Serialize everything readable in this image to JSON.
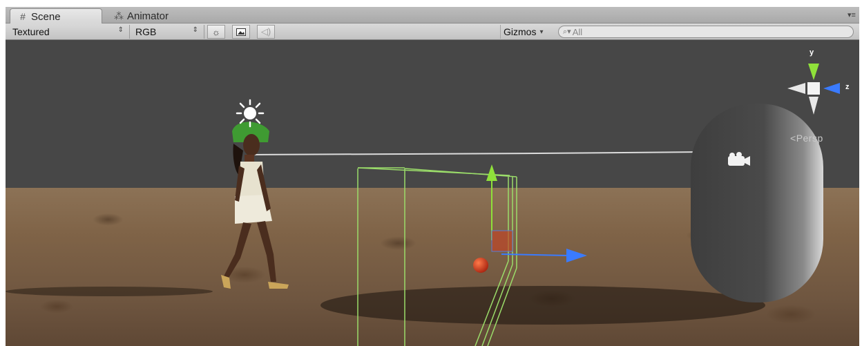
{
  "tabs": [
    {
      "label": "Scene",
      "icon": "grid-icon",
      "active": true
    },
    {
      "label": "Animator",
      "icon": "animator-icon",
      "active": false
    }
  ],
  "toolbar": {
    "render_mode": "Textured",
    "color_mode": "RGB",
    "lighting_icon": "sun-icon",
    "image_icon": "image-icon",
    "audio_icon": "speaker-icon",
    "gizmos_label": "Gizmos",
    "search_placeholder": "All"
  },
  "viewport": {
    "projection_label": "Persp",
    "axis_y": "y",
    "axis_z": "z",
    "colors": {
      "sky": "#474747",
      "ground": "#7f6347",
      "x_axis": "#3a7bff",
      "y_axis": "#8fe13a",
      "capsule": "#4d4d4d",
      "bounds_wire": "#9bdd6a",
      "sphere": "#c63a1f"
    }
  }
}
